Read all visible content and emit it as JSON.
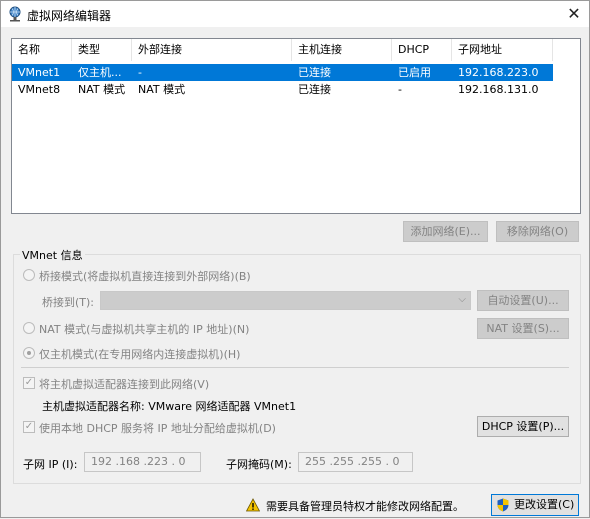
{
  "window": {
    "title": "虚拟网络编辑器",
    "close_icon": "close-icon"
  },
  "table": {
    "headers": [
      "名称",
      "类型",
      "外部连接",
      "主机连接",
      "DHCP",
      "子网地址"
    ],
    "rows": [
      {
        "name": "VMnet1",
        "type": "仅主机...",
        "external": "-",
        "host": "已连接",
        "dhcp": "已启用",
        "subnet": "192.168.223.0",
        "selected": true
      },
      {
        "name": "VMnet8",
        "type": "NAT 模式",
        "external": "NAT 模式",
        "host": "已连接",
        "dhcp": "-",
        "subnet": "192.168.131.0",
        "selected": false
      }
    ]
  },
  "buttons": {
    "add_network": "添加网络(E)...",
    "remove_network": "移除网络(O)",
    "auto_settings": "自动设置(U)...",
    "nat_settings": "NAT 设置(S)...",
    "dhcp_settings": "DHCP 设置(P)...",
    "change_settings": "更改设置(C)"
  },
  "vmnet_info": {
    "group_title": "VMnet 信息",
    "bridged_mode": "桥接模式(将虚拟机直接连接到外部网络)(B)",
    "bridged_to_label": "桥接到(T):",
    "bridged_to_value": "",
    "nat_mode": "NAT 模式(与虚拟机共享主机的 IP 地址)(N)",
    "host_only_mode": "仅主机模式(在专用网络内连接虚拟机)(H)",
    "connect_adapter": "将主机虚拟适配器连接到此网络(V)",
    "adapter_name": "主机虚拟适配器名称: VMware 网络适配器 VMnet1",
    "use_dhcp": "使用本地 DHCP 服务将 IP 地址分配给虚拟机(D)",
    "subnet_ip_label": "子网 IP (I):",
    "subnet_ip": "192 .168 .223 .  0",
    "subnet_mask_label": "子网掩码(M):",
    "subnet_mask": "255 .255 .255 .  0",
    "selected_mode": "host-only",
    "connect_adapter_checked": true,
    "use_dhcp_checked": true
  },
  "footer": {
    "warning": "需要具备管理员特权才能修改网络配置。",
    "warning_icon": "warning-icon",
    "shield_icon": "uac-shield-icon"
  },
  "colors": {
    "selection": "#0078d7",
    "disabled_text": "#838383"
  }
}
